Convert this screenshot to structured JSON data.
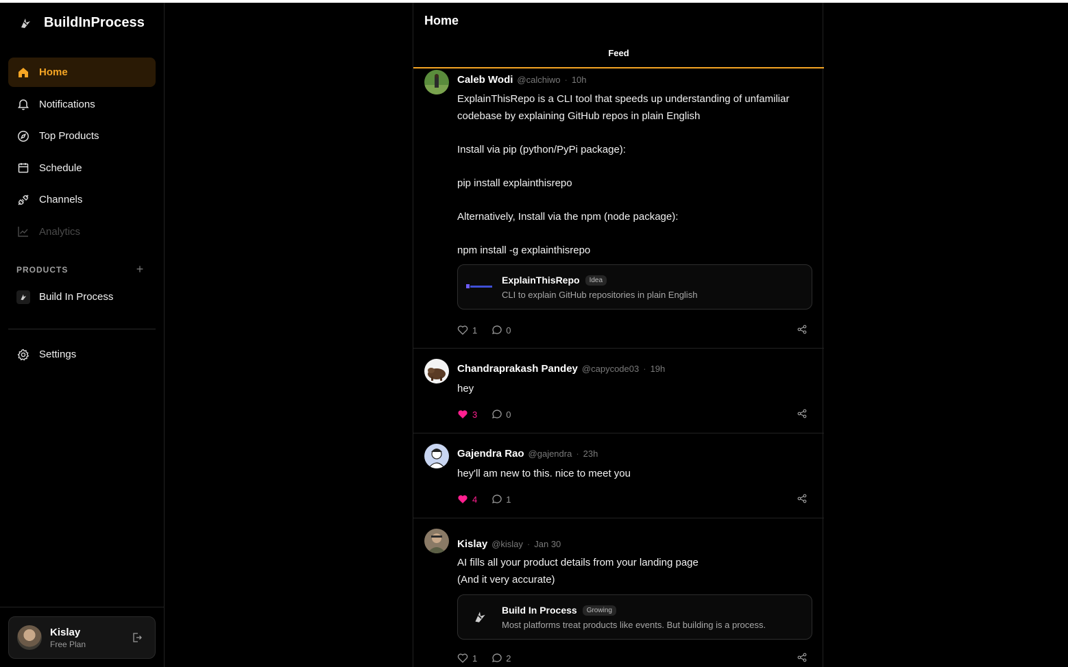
{
  "app": {
    "name": "BuildInProcess"
  },
  "sidebar": {
    "nav": [
      {
        "label": "Home",
        "icon": "home-icon",
        "active": true
      },
      {
        "label": "Notifications",
        "icon": "bell-icon"
      },
      {
        "label": "Top Products",
        "icon": "compass-icon"
      },
      {
        "label": "Schedule",
        "icon": "calendar-icon"
      },
      {
        "label": "Channels",
        "icon": "plug-icon"
      },
      {
        "label": "Analytics",
        "icon": "chart-icon",
        "disabled": true
      }
    ],
    "products_label": "PRODUCTS",
    "products_add": "+",
    "products": [
      {
        "label": "Build In Process"
      }
    ],
    "settings_label": "Settings",
    "user": {
      "name": "Kislay",
      "plan": "Free Plan"
    }
  },
  "main": {
    "title": "Home",
    "tab": "Feed",
    "posts": [
      {
        "author": "Caleb Wodi",
        "handle": "@calchiwo",
        "time": "10h",
        "body": "ExplainThisRepo is a CLI tool that speeds up understanding of unfamiliar codebase by explaining GitHub repos in plain English\n\nInstall via pip (python/PyPi package):\n\npip install explainthisrepo\n\nAlternatively, Install via the npm (node package):\n\nnpm install -g explainthisrepo",
        "embed": {
          "title": "ExplainThisRepo",
          "tag": "Idea",
          "desc": "CLI to explain GitHub repositories in plain English"
        },
        "likes": "1",
        "comments": "0",
        "liked": false
      },
      {
        "author": "Chandraprakash Pandey",
        "handle": "@capycode03",
        "time": "19h",
        "body": "hey",
        "likes": "3",
        "comments": "0",
        "liked": true
      },
      {
        "author": "Gajendra Rao",
        "handle": "@gajendra",
        "time": "23h",
        "body": "hey'll am new to this. nice to meet you",
        "likes": "4",
        "comments": "1",
        "liked": true
      },
      {
        "author": "Kislay",
        "handle": "@kislay",
        "time": "Jan 30",
        "body": "AI fills all your product details from your landing page\n(And it very accurate)",
        "embed": {
          "title": "Build In Process",
          "tag": "Growing",
          "desc": "Most platforms treat products like events. But building is a process."
        },
        "likes": "1",
        "comments": "2",
        "liked": false
      }
    ]
  },
  "colors": {
    "accent": "#f5a524",
    "like": "#ff1f8f",
    "background": "#000000"
  }
}
